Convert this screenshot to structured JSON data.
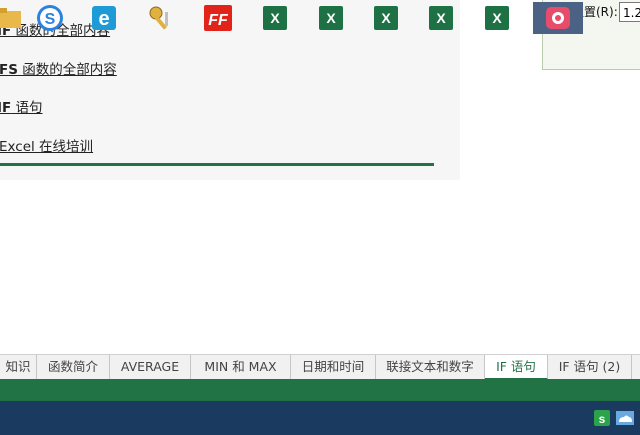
{
  "links": [
    {
      "bold": "IF",
      "text": " 函数的全部内容"
    },
    {
      "bold": "IFS",
      "text": " 函数的全部内容"
    },
    {
      "bold": "IF",
      "text": " 语句"
    },
    {
      "bold": "",
      "text": "Excel 在线培训"
    }
  ],
  "reference": {
    "label": "引用位置(R):",
    "value": "1.2"
  },
  "sheet_tabs": [
    {
      "label": "知识"
    },
    {
      "label": "函数简介"
    },
    {
      "label": "AVERAGE"
    },
    {
      "label": "MIN 和 MAX"
    },
    {
      "label": "日期和时间"
    },
    {
      "label": "联接文本和数字"
    },
    {
      "label": "IF 语句"
    },
    {
      "label": "IF 语句 (2)"
    }
  ],
  "active_tab": "IF 语句",
  "colors": {
    "excel_green": "#217346",
    "taskbar": "#1b3a60"
  },
  "taskbar_icons": [
    "file-explorer-icon",
    "sogou-icon",
    "internet-explorer-icon",
    "keys-icon",
    "foxit-reader-icon",
    "excel-icon",
    "excel-icon",
    "excel-icon",
    "excel-icon",
    "excel-icon",
    "screen-recorder-icon"
  ],
  "tray_icons": [
    "sogou-input-icon",
    "onedrive-icon"
  ]
}
